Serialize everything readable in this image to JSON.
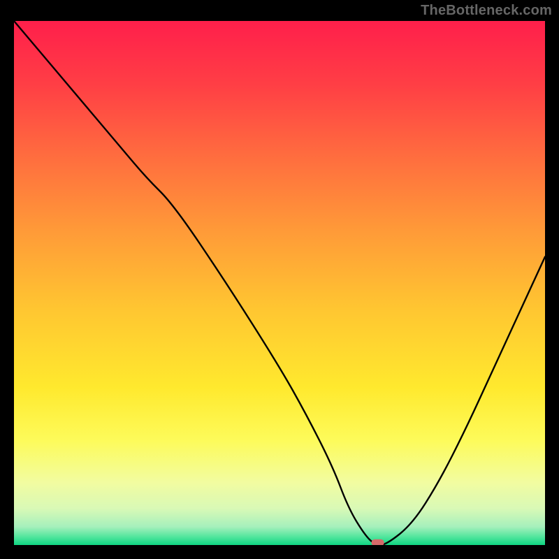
{
  "watermark": "TheBottleneck.com",
  "chart_data": {
    "type": "line",
    "title": "",
    "xlabel": "",
    "ylabel": "",
    "xlim": [
      0,
      100
    ],
    "ylim": [
      0,
      100
    ],
    "grid": false,
    "series": [
      {
        "name": "bottleneck-curve",
        "x": [
          0,
          10,
          20,
          25,
          30,
          40,
          50,
          55,
          60,
          63,
          66,
          68,
          70,
          75,
          80,
          85,
          90,
          95,
          100
        ],
        "y": [
          100,
          88,
          76,
          70,
          65,
          50,
          34,
          25,
          15,
          7,
          2,
          0,
          0,
          4,
          12,
          22,
          33,
          44,
          55
        ]
      }
    ],
    "marker": {
      "x": 68.5,
      "y": 0,
      "color": "#d66a6a",
      "shape": "rounded-rect",
      "width": 2.4,
      "height": 1.3
    },
    "gradient_stops": [
      {
        "offset": 0.0,
        "color": "#ff1f4b"
      },
      {
        "offset": 0.12,
        "color": "#ff3e45"
      },
      {
        "offset": 0.25,
        "color": "#ff6a3f"
      },
      {
        "offset": 0.4,
        "color": "#ff9a38"
      },
      {
        "offset": 0.55,
        "color": "#ffc631"
      },
      {
        "offset": 0.7,
        "color": "#ffe92e"
      },
      {
        "offset": 0.8,
        "color": "#fdfb5a"
      },
      {
        "offset": 0.88,
        "color": "#f2fca0"
      },
      {
        "offset": 0.93,
        "color": "#d9f9b6"
      },
      {
        "offset": 0.965,
        "color": "#a6f0bc"
      },
      {
        "offset": 0.985,
        "color": "#4fe59c"
      },
      {
        "offset": 1.0,
        "color": "#0fd582"
      }
    ]
  }
}
